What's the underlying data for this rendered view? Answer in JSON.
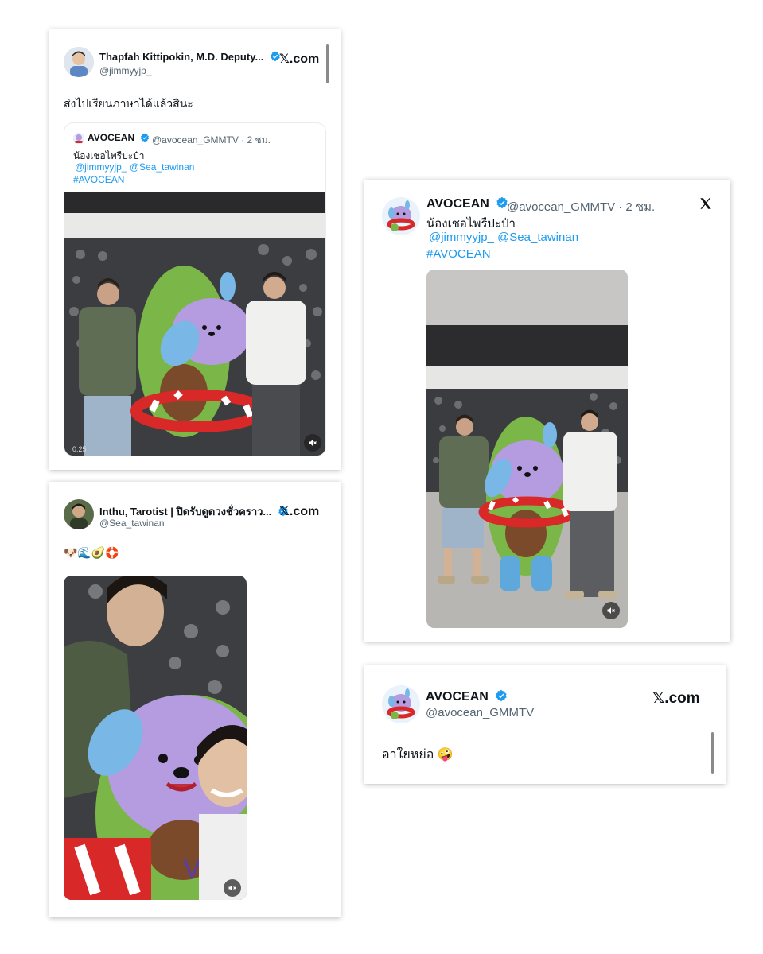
{
  "cards": {
    "thapfah": {
      "name": "Thapfah Kittipokin, M.D. Deputy...",
      "handle": "@jimmyyjp_",
      "brand": "𝕏.com",
      "text": "ส่งไปเรียนภาษาได้แล้วสินะ",
      "quote": {
        "name": "AVOCEAN",
        "handle_time": "@avocean_GMMTV · 2 ชม.",
        "line1": "น้องเชอไพรืปะป๋า",
        "mention1": "@jimmyyjp_",
        "mention2": "@Sea_tawinan",
        "hashtag": "#AVOCEAN",
        "video_time": "0:25"
      }
    },
    "inthu": {
      "name": "Inthu, Tarotist | ปิดรับดูดวงชั่วคราว...",
      "handle": "@Sea_tawinan",
      "brand": "𝕏.com",
      "emojis": "🐶🌊🥑🛟"
    },
    "avocean_post": {
      "name": "AVOCEAN",
      "handle_time": "@avocean_GMMTV · 2 ชม.",
      "line1": "น้องเชอไพรืปะป๋า",
      "mention1": "@jimmyyjp_",
      "mention2": "@Sea_tawinan",
      "hashtag": "#AVOCEAN"
    },
    "avocean_reply": {
      "name": "AVOCEAN",
      "handle": "@avocean_GMMTV",
      "brand": "𝕏.com",
      "text": "อาใยหย่อ",
      "emoji": "🤪"
    }
  },
  "icons": {
    "verified": "verified-badge-icon",
    "x_logo": "x-logo-icon",
    "mute": "muted-speaker-icon"
  },
  "colors": {
    "verified": "#1d9bf0",
    "link": "#1d9bf0",
    "mascot_body": "#a98fd6",
    "avocado": "#7ab648",
    "ring_red": "#d82828"
  }
}
